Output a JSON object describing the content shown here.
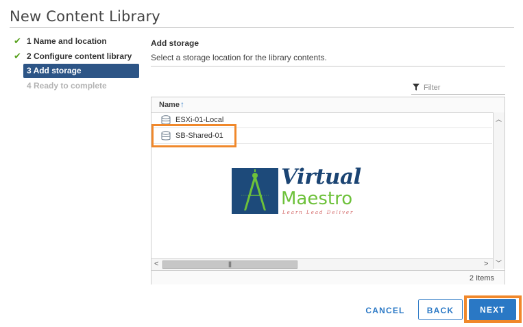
{
  "window": {
    "title": "New Content Library"
  },
  "steps": [
    {
      "label": "1 Name and location",
      "status": "done"
    },
    {
      "label": "2 Configure content library",
      "status": "done"
    },
    {
      "label": "3 Add storage",
      "status": "active"
    },
    {
      "label": "4 Ready to complete",
      "status": "pending"
    }
  ],
  "section": {
    "title": "Add storage",
    "description": "Select a storage location for the library contents."
  },
  "filter": {
    "placeholder": "Filter"
  },
  "grid": {
    "column_header": "Name",
    "rows": [
      {
        "name": "ESXi-01-Local",
        "icon": "datastore-icon"
      },
      {
        "name": "SB-Shared-01",
        "icon": "datastore-icon"
      }
    ],
    "item_count": "2 Items"
  },
  "logo": {
    "line1": "Virtual",
    "line2": "Maestro",
    "tagline": "Learn  Lead  Deliver"
  },
  "buttons": {
    "cancel": "CANCEL",
    "back": "BACK",
    "next": "NEXT"
  },
  "colors": {
    "accent": "#2a78c5",
    "active_step_bg": "#2d5586",
    "check_green": "#5aa220",
    "highlight_orange": "#f0882b"
  }
}
